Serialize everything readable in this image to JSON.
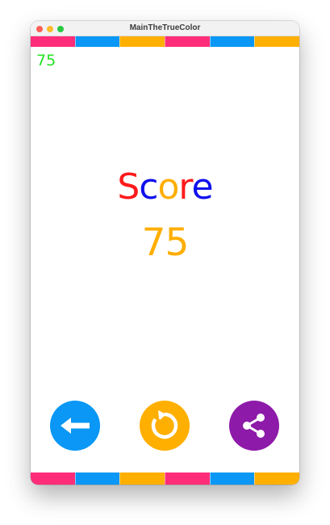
{
  "window": {
    "title": "MainTheTrueColor"
  },
  "stripe_colors": [
    "#ff2d79",
    "#0a97f5",
    "#ffaf00",
    "#ff2d79",
    "#0a97f5",
    "#ffaf00"
  ],
  "header": {
    "score_small": "75"
  },
  "main": {
    "score_label_letters": [
      {
        "char": "S",
        "color": "#ff1b1b"
      },
      {
        "char": "c",
        "color": "#1010ee"
      },
      {
        "char": "o",
        "color": "#ffae00"
      },
      {
        "char": "r",
        "color": "#ff1b1b"
      },
      {
        "char": "e",
        "color": "#1010ee"
      }
    ],
    "score_value": "75"
  },
  "buttons": [
    {
      "name": "back-button",
      "icon": "arrow-left-icon",
      "color": "#0a97f5"
    },
    {
      "name": "restart-button",
      "icon": "refresh-icon",
      "color": "#ffaf00"
    },
    {
      "name": "share-button",
      "icon": "share-icon",
      "color": "#8d1aa8"
    }
  ]
}
